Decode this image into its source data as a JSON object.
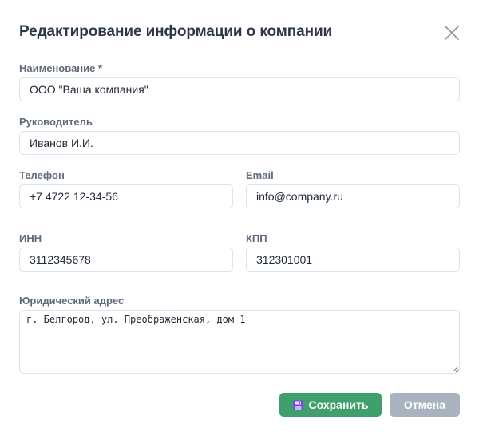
{
  "dialog": {
    "title": "Редактирование информации о компании"
  },
  "form": {
    "name": {
      "label": "Наименование *",
      "value": "ООО \"Ваша компания\""
    },
    "director": {
      "label": "Руководитель",
      "value": "Иванов И.И."
    },
    "phone": {
      "label": "Телефон",
      "value": "+7 4722 12-34-56"
    },
    "email": {
      "label": "Email",
      "value": "info@company.ru"
    },
    "inn": {
      "label": "ИНН",
      "value": "3112345678"
    },
    "kpp": {
      "label": "КПП",
      "value": "312301001"
    },
    "address": {
      "label": "Юридический адрес",
      "value": "г. Белгород, ул. Преображенская, дом 1"
    }
  },
  "buttons": {
    "save_label": "Сохранить",
    "cancel_label": "Отмена"
  },
  "colors": {
    "save_button": "#3fa06d",
    "cancel_button": "#a9b3bf",
    "save_icon": "#7c3aed"
  }
}
